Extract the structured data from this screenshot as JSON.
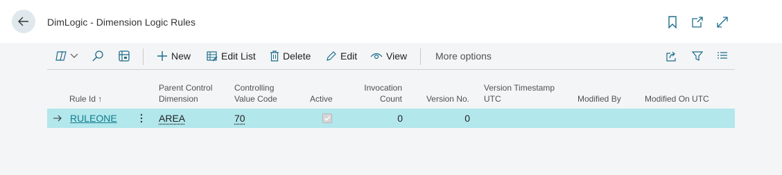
{
  "header": {
    "title": "DimLogic - Dimension Logic Rules",
    "icons": [
      "back-arrow-icon",
      "bookmark-icon",
      "open-new-window-icon",
      "expand-icon"
    ]
  },
  "toolbar": {
    "new_label": "New",
    "edit_list_label": "Edit List",
    "delete_label": "Delete",
    "edit_label": "Edit",
    "view_label": "View",
    "more_options_label": "More options"
  },
  "table": {
    "columns": {
      "rule_id": "Rule Id",
      "rule_id_sort": "↑",
      "parent_control_dimension_1": "Parent Control",
      "parent_control_dimension_2": "Dimension",
      "controlling_value_code_1": "Controlling",
      "controlling_value_code_2": "Value Code",
      "active": "Active",
      "invocation_count_1": "Invocation",
      "invocation_count_2": "Count",
      "version_no": "Version No.",
      "version_timestamp_1": "Version Timestamp",
      "version_timestamp_2": "UTC",
      "modified_by": "Modified By",
      "modified_on": "Modified On UTC"
    },
    "rows": [
      {
        "rule_id": "RULEONE",
        "parent_control_dimension": "AREA",
        "controlling_value_code": "70",
        "active": true,
        "invocation_count": "0",
        "version_no": "0",
        "version_timestamp": "",
        "modified_by": "",
        "modified_on": ""
      }
    ]
  },
  "colors": {
    "accent": "#0f7b8a",
    "selected_row": "#b2e7ec",
    "content_bg": "#f4f5f6"
  }
}
